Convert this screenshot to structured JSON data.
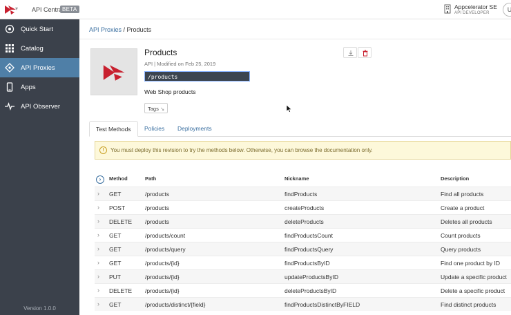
{
  "header": {
    "app_name": "API Central",
    "beta_label": "BETA",
    "org_name": "Appcelerator SE",
    "org_role": "API DEVELOPER",
    "avatar_initials": "U"
  },
  "sidebar": {
    "items": [
      {
        "label": "Quick Start",
        "icon": "rocket-icon"
      },
      {
        "label": "Catalog",
        "icon": "grid-icon"
      },
      {
        "label": "API Proxies",
        "icon": "proxy-icon"
      },
      {
        "label": "Apps",
        "icon": "device-icon"
      },
      {
        "label": "API Observer",
        "icon": "pulse-icon"
      }
    ],
    "active_index": 2,
    "version": "Version 1.0.0"
  },
  "breadcrumb": {
    "parent": "API Proxies",
    "separator": " / ",
    "current": "Products"
  },
  "product": {
    "title": "Products",
    "meta": "API  |  Modified on Feb 25, 2019",
    "path": "/products",
    "description": "Web Shop products",
    "tags_label": "Tags"
  },
  "tabs": [
    "Test Methods",
    "Policies",
    "Deployments"
  ],
  "warning": "You must deploy this revision to try the methods below. Otherwise, you can browse the documentation only.",
  "table": {
    "headers": {
      "method": "Method",
      "path": "Path",
      "nickname": "Nickname",
      "description": "Description"
    },
    "rows": [
      {
        "method": "GET",
        "path": "/products",
        "nickname": "findProducts",
        "description": "Find all products"
      },
      {
        "method": "POST",
        "path": "/products",
        "nickname": "createProducts",
        "description": "Create a product"
      },
      {
        "method": "DELETE",
        "path": "/products",
        "nickname": "deleteProducts",
        "description": "Deletes all products"
      },
      {
        "method": "GET",
        "path": "/products/count",
        "nickname": "findProductsCount",
        "description": "Count products"
      },
      {
        "method": "GET",
        "path": "/products/query",
        "nickname": "findProductsQuery",
        "description": "Query products"
      },
      {
        "method": "GET",
        "path": "/products/{id}",
        "nickname": "findProductsByID",
        "description": "Find one product by ID"
      },
      {
        "method": "PUT",
        "path": "/products/{id}",
        "nickname": "updateProductsByID",
        "description": "Update a specific product"
      },
      {
        "method": "DELETE",
        "path": "/products/{id}",
        "nickname": "deleteProductsByID",
        "description": "Delete a specific product"
      },
      {
        "method": "GET",
        "path": "/products/distinct/{field}",
        "nickname": "findProductsDistinctByFIELD",
        "description": "Find distinct products"
      }
    ]
  },
  "colors": {
    "sidebar_bg": "#3b414b",
    "active_nav": "#4f7fa7",
    "brand_red": "#c8202f",
    "link": "#3a6fa0",
    "warning_bg": "#fdf8da"
  }
}
